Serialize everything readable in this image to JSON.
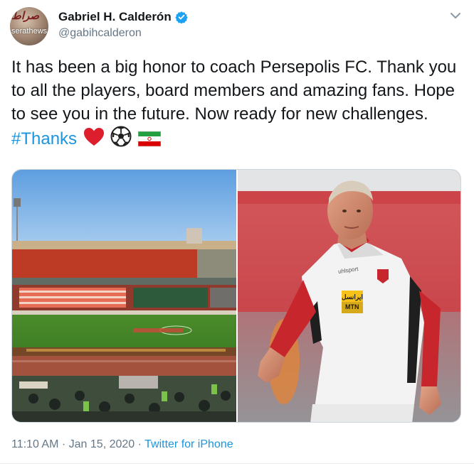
{
  "author": {
    "display_name": "Gabriel H. Calderón",
    "handle": "@gabihcalderon",
    "avatar_watermark_top": "صراط",
    "avatar_watermark_bottom": "serathews"
  },
  "tweet": {
    "text": "It has been a big honor to coach Persepolis FC. Thank you to all the players, board members and amazing fans. Hope to see you in the future. Now ready for new challenges.",
    "hashtag": "#Thanks",
    "emojis": [
      "red-heart",
      "soccer-ball",
      "iran-flag"
    ]
  },
  "media": {
    "left_photo": "stadium-crowd",
    "right_photo": "coach-portrait",
    "shirt_brand": "uhlsport",
    "sponsor_text_top": "ايرانسل",
    "sponsor_text_bottom": "MTN"
  },
  "meta": {
    "time": "11:10 AM",
    "separator": "·",
    "date": "Jan 15, 2020",
    "source": "Twitter for iPhone"
  },
  "colors": {
    "link": "#1b95e0",
    "secondary_text": "#657786",
    "verified": "#1da1f2",
    "persepolis_red": "#d7242a"
  }
}
